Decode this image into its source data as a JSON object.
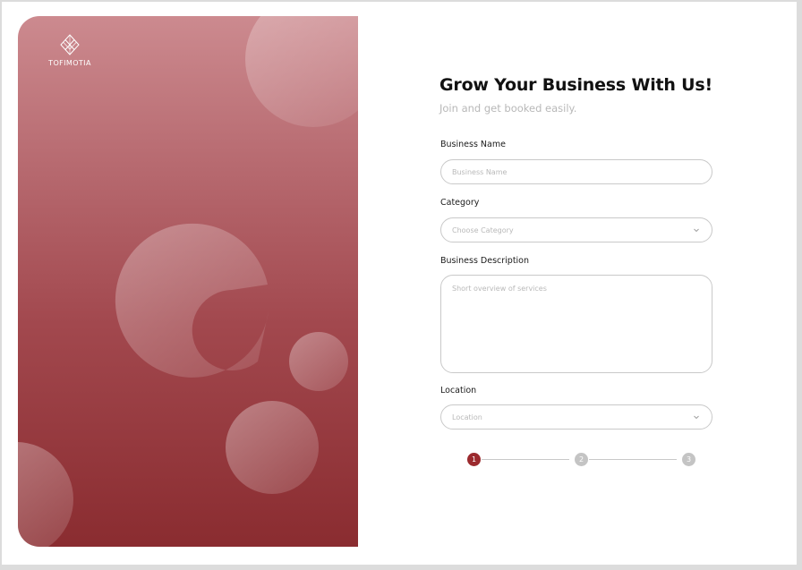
{
  "brand": {
    "name": "TOFIMOTIA",
    "logo_icon": "diamond-lattice-icon",
    "hero_gradient": [
      "#cc8a8f",
      "#8a2c30"
    ]
  },
  "form": {
    "title": "Grow Your Business With Us!",
    "subtitle": "Join and get booked easily.",
    "business_name": {
      "label": "Business Name",
      "placeholder": "Business Name",
      "value": ""
    },
    "category": {
      "label": "Category",
      "placeholder": "Choose Category",
      "icon": "chevron-down-icon"
    },
    "description": {
      "label": "Business Description",
      "placeholder": "Short overview of services",
      "value": ""
    },
    "location": {
      "label": "Location",
      "placeholder": "Location",
      "icon": "chevron-down-icon"
    }
  },
  "stepper": {
    "steps": [
      "1",
      "2",
      "3"
    ],
    "current": 1,
    "active_color": "#9b2a2e",
    "inactive_color": "#c4c4c4"
  }
}
